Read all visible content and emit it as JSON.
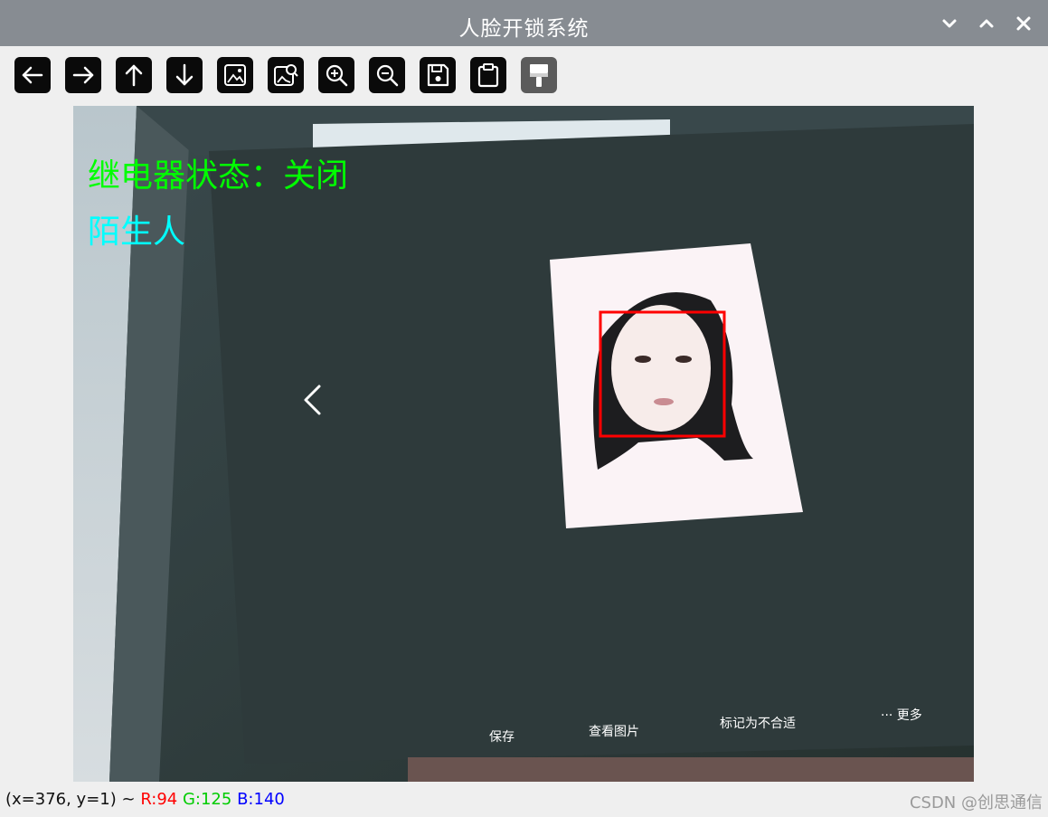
{
  "window": {
    "title": "人脸开锁系统"
  },
  "toolbar": {
    "buttons": [
      {
        "name": "pan-left",
        "icon": "arrow-left-icon"
      },
      {
        "name": "pan-right",
        "icon": "arrow-right-icon"
      },
      {
        "name": "pan-up",
        "icon": "arrow-up-icon"
      },
      {
        "name": "pan-down",
        "icon": "arrow-down-icon"
      },
      {
        "name": "zoom-fit",
        "icon": "image-icon"
      },
      {
        "name": "zoom-original",
        "icon": "image-search-icon"
      },
      {
        "name": "zoom-in",
        "icon": "zoom-in-icon"
      },
      {
        "name": "zoom-out",
        "icon": "zoom-out-icon"
      },
      {
        "name": "save",
        "icon": "save-icon"
      },
      {
        "name": "copy",
        "icon": "clipboard-icon"
      },
      {
        "name": "properties",
        "icon": "paint-brush-icon",
        "disabled": true
      }
    ]
  },
  "overlay": {
    "relay_status": "继电器状态：关闭",
    "identity": "陌生人",
    "relay_color": "#00ff00",
    "identity_color": "#00ffff",
    "face_box_color": "#ff0000"
  },
  "camera_scene": {
    "bottom_actions": [
      "保存",
      "查看图片",
      "标记为不合适",
      "··· 更多"
    ]
  },
  "status": {
    "coords": "(x=376, y=1) ~",
    "r": "R:94",
    "g": "G:125",
    "b": "B:140",
    "r_color": "#ff0000",
    "g_color": "#00cc00",
    "b_color": "#0000ff"
  },
  "watermark": "CSDN @创思通信"
}
